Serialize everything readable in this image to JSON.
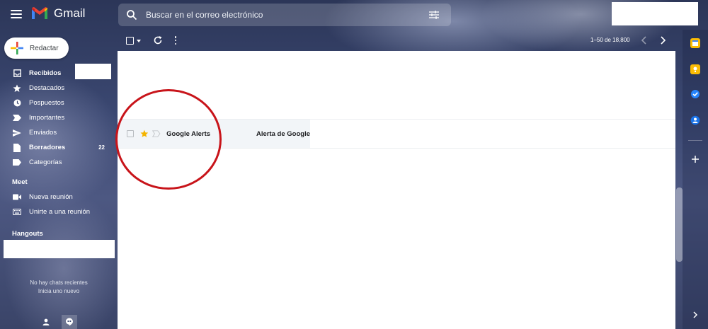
{
  "header": {
    "app_name": "Gmail",
    "search_placeholder": "Buscar en el correo electrónico"
  },
  "sidebar": {
    "compose_label": "Redactar",
    "items": [
      {
        "label": "Recibidos",
        "icon": "inbox-icon",
        "active": true,
        "count": ""
      },
      {
        "label": "Destacados",
        "icon": "star-icon",
        "active": false,
        "count": ""
      },
      {
        "label": "Pospuestos",
        "icon": "clock-icon",
        "active": false,
        "count": ""
      },
      {
        "label": "Importantes",
        "icon": "important-icon",
        "active": false,
        "count": ""
      },
      {
        "label": "Enviados",
        "icon": "send-icon",
        "active": false,
        "count": ""
      },
      {
        "label": "Borradores",
        "icon": "draft-icon",
        "active": false,
        "count": "22"
      },
      {
        "label": "Categorías",
        "icon": "label-icon",
        "active": false,
        "count": ""
      }
    ],
    "meet": {
      "title": "Meet",
      "items": [
        {
          "label": "Nueva reunión",
          "icon": "video-icon"
        },
        {
          "label": "Unirte a una reunión",
          "icon": "keyboard-icon"
        }
      ]
    },
    "hangouts": {
      "title": "Hangouts",
      "no_chats_line1": "No hay chats recientes",
      "no_chats_line2": "Inicia uno nuevo"
    }
  },
  "toolbar": {
    "pagination": "1–50 de 18,800"
  },
  "mail_list": [
    {
      "sender": "Google Alerts",
      "subject": "Alerta de Google",
      "starred": true
    }
  ],
  "colors": {
    "annotation": "#c8141a",
    "star": "#f4b400",
    "row_bg": "#f2f5f8"
  }
}
